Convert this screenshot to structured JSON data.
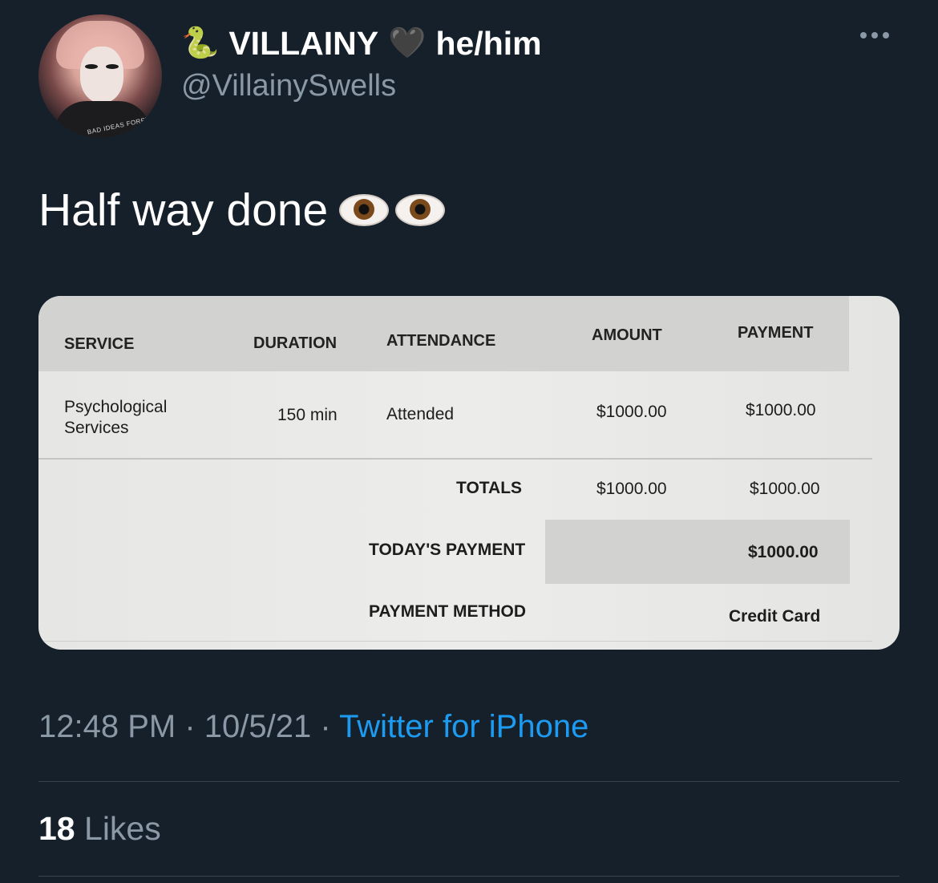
{
  "user": {
    "display_name": "VILLAINY",
    "pronouns": "he/him",
    "handle": "@VillainySwells",
    "name_emoji_left": "snake-icon",
    "name_emoji_right": "black-heart-icon",
    "avatar_shirt_text": "BAD IDEAS FOREVER"
  },
  "tweet": {
    "text": "Half way done",
    "emoji": [
      "eye-icon",
      "eye-icon"
    ]
  },
  "receipt": {
    "headers": [
      "SERVICE",
      "DURATION",
      "ATTENDANCE",
      "AMOUNT",
      "PAYMENT"
    ],
    "row": {
      "service_line1": "Psychological",
      "service_line2": "Services",
      "duration": "150 min",
      "attendance": "Attended",
      "amount": "$1000.00",
      "payment": "$1000.00"
    },
    "totals": {
      "label": "TOTALS",
      "amount": "$1000.00",
      "payment": "$1000.00"
    },
    "todays_payment": {
      "label": "TODAY'S PAYMENT",
      "value": "$1000.00"
    },
    "payment_method": {
      "label": "PAYMENT METHOD",
      "value": "Credit Card"
    }
  },
  "meta": {
    "time": "12:48 PM",
    "separator": " · ",
    "date": "10/5/21",
    "source": "Twitter for iPhone"
  },
  "stats": {
    "likes_count": "18",
    "likes_label": "Likes"
  },
  "colors": {
    "background": "#15202b",
    "secondary_text": "#8b98a5",
    "link": "#1d9bf0"
  }
}
